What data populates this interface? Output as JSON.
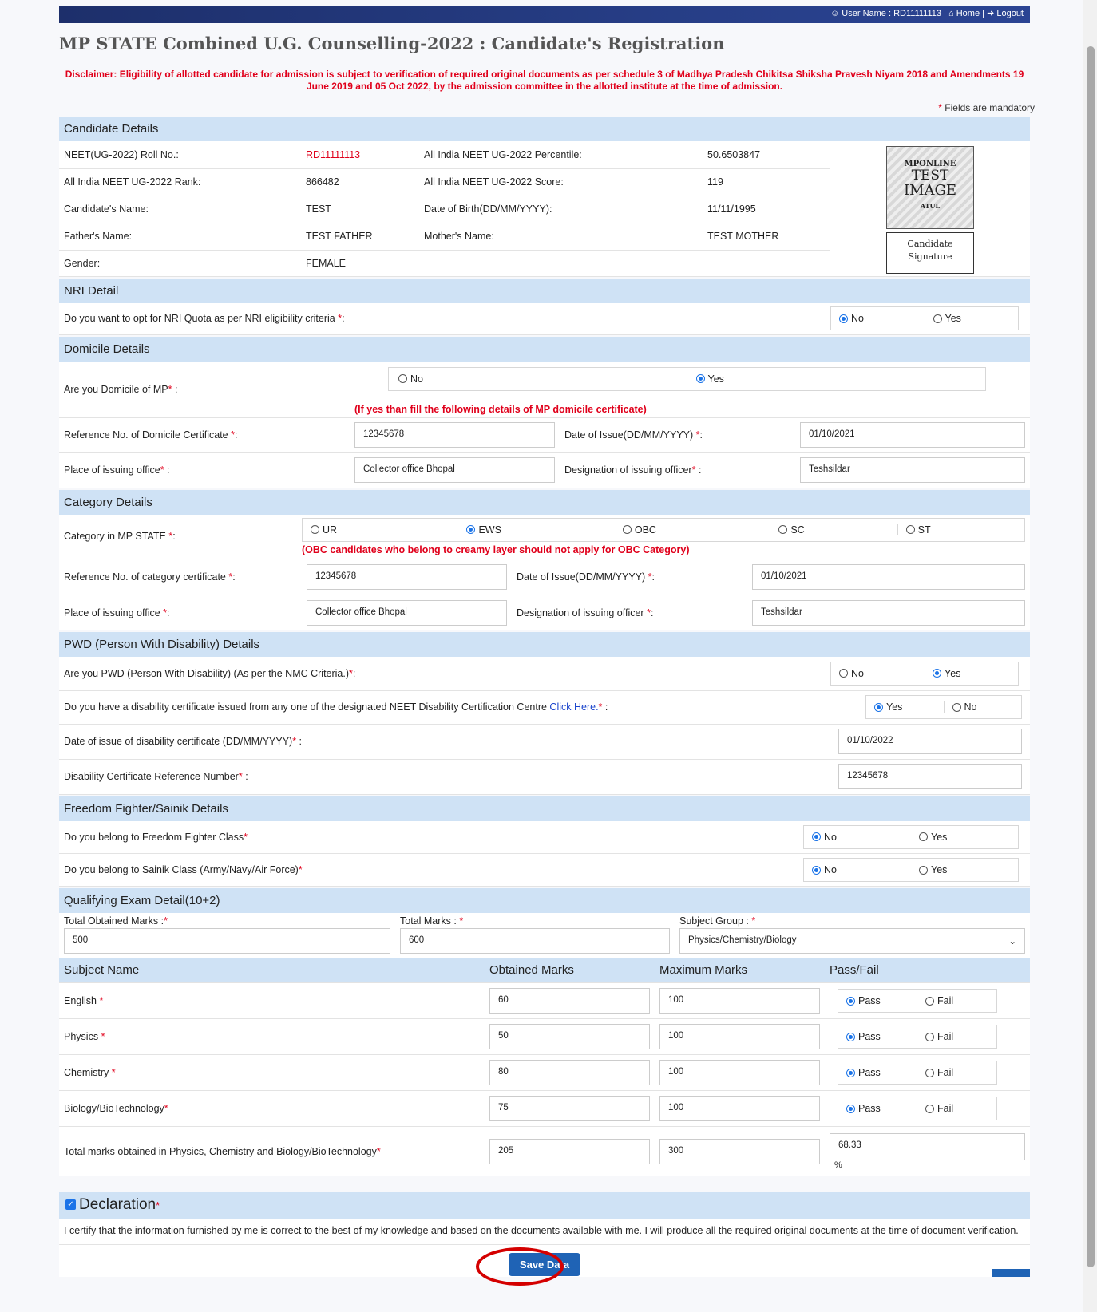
{
  "topbar": {
    "user": "User Name : RD11111113",
    "home": "Home",
    "logout": "Logout",
    "sep": "|"
  },
  "title": "MP STATE Combined U.G. Counselling-2022 : Candidate's Registration",
  "disclaimer": "Disclaimer: Eligibility of allotted candidate for admission is subject to verification of required original documents as per schedule 3 of Madhya Pradesh Chikitsa Shiksha Pravesh Niyam 2018 and Amendments 19 June 2019 and 05 Oct 2022, by the admission committee in the allotted institute at the time of admission.",
  "mandatory_note": "Fields are mandatory",
  "candidate": {
    "heading": "Candidate Details",
    "roll_label": "NEET(UG-2022) Roll No.:",
    "roll": "RD11111113",
    "percentile_label": "All India NEET UG-2022 Percentile:",
    "percentile": "50.6503847",
    "rank_label": "All India NEET UG-2022 Rank:",
    "rank": "866482",
    "score_label": "All India NEET UG-2022 Score:",
    "score": "119",
    "name_label": "Candidate's Name:",
    "name": "TEST",
    "dob_label": "Date of Birth(DD/MM/YYYY):",
    "dob": "11/11/1995",
    "father_label": "Father's Name:",
    "father": "TEST FATHER",
    "mother_label": "Mother's Name:",
    "mother": "TEST MOTHER",
    "gender_label": "Gender:",
    "gender": "FEMALE",
    "photo": {
      "l1": "MPONLINE",
      "l2": "TEST",
      "l3": "IMAGE",
      "l4": "ATUL"
    },
    "signature": {
      "l1": "Candidate",
      "l2": "Signature"
    }
  },
  "nri": {
    "heading": "NRI Detail",
    "question": "Do you want to opt for NRI Quota as per NRI eligibility criteria",
    "opt_no": "No",
    "opt_yes": "Yes"
  },
  "domicile": {
    "heading": "Domicile Details",
    "question": "Are you Domicile of MP",
    "opt_no": "No",
    "opt_yes": "Yes",
    "note": "(If yes than fill the following details of MP domicile certificate)",
    "ref_label": "Reference No. of Domicile Certificate",
    "ref": "12345678",
    "date_label": "Date of Issue(DD/MM/YYYY)",
    "date": "01/10/2021",
    "place_label": "Place of issuing office",
    "place": "Collector office Bhopal",
    "desig_label": "Designation of issuing officer",
    "desig": "Teshsildar"
  },
  "category": {
    "heading": "Category Details",
    "question": "Category in MP STATE",
    "options": [
      "UR",
      "EWS",
      "OBC",
      "SC",
      "ST"
    ],
    "note": "(OBC candidates who belong to creamy layer should not apply for OBC Category)",
    "ref_label": "Reference No. of category certificate",
    "ref": "12345678",
    "date_label": "Date of Issue(DD/MM/YYYY)",
    "date": "01/10/2021",
    "place_label": "Place of issuing office",
    "place": "Collector office Bhopal",
    "desig_label": "Designation of issuing officer",
    "desig": "Teshsildar"
  },
  "pwd": {
    "heading": "PWD (Person With Disability) Details",
    "q1": "Are you PWD (Person With Disability) (As per the NMC Criteria.)",
    "q1_no": "No",
    "q1_yes": "Yes",
    "q2": "Do you have a disability certificate issued from any one of the designated NEET Disability Certification Centre",
    "q2_link": "Click Here.",
    "q2_yes": "Yes",
    "q2_no": "No",
    "date_label": "Date of issue of disability certificate (DD/MM/YYYY)",
    "date": "01/10/2022",
    "ref_label": "Disability Certificate Reference Number",
    "ref": "12345678"
  },
  "freedom": {
    "heading": "Freedom Fighter/Sainik Details",
    "q1": "Do you belong to Freedom Fighter Class",
    "q2": "Do you belong to Sainik Class (Army/Navy/Air Force)",
    "opt_no": "No",
    "opt_yes": "Yes"
  },
  "qualifying": {
    "heading": "Qualifying Exam Detail(10+2)",
    "obtained_label": "Total Obtained Marks :",
    "obtained": "500",
    "total_label": "Total Marks :",
    "total": "600",
    "group_label": "Subject Group :",
    "group": "Physics/Chemistry/Biology",
    "headers": [
      "Subject Name",
      "Obtained Marks",
      "Maximum Marks",
      "Pass/Fail"
    ],
    "subjects": [
      {
        "name": "English",
        "obtained": "60",
        "max": "100"
      },
      {
        "name": "Physics",
        "obtained": "50",
        "max": "100"
      },
      {
        "name": "Chemistry",
        "obtained": "80",
        "max": "100"
      },
      {
        "name": "Biology/BioTechnology",
        "obtained": "75",
        "max": "100"
      }
    ],
    "pass": "Pass",
    "fail": "Fail",
    "pcb_label": "Total marks obtained in Physics, Chemistry and Biology/BioTechnology",
    "pcb_obtained": "205",
    "pcb_max": "300",
    "pcb_percent": "68.33",
    "percent_sign": "%"
  },
  "declaration": {
    "heading": "Declaration",
    "text": "I certify that the information furnished by me is correct to the best of my knowledge and based on the documents available with me. I will produce all the required original documents at the time of document verification."
  },
  "save_button": "Save Data",
  "colors": {
    "header_bar": "#263d85",
    "section_bg": "#cfe2f5",
    "accent": "#1a73e8",
    "required": "#e0001b",
    "button": "#1f63b5"
  }
}
